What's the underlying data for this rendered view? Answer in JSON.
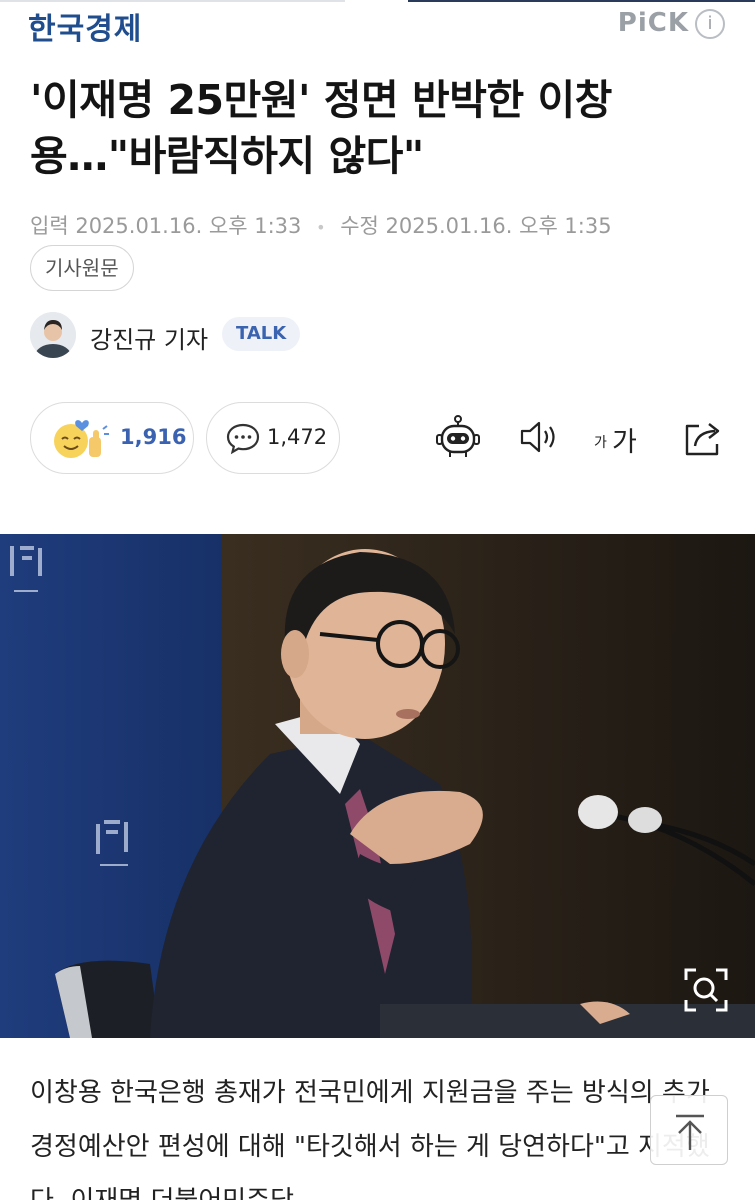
{
  "header": {
    "brand": "한국경제",
    "pick": "PiCK",
    "info": "i"
  },
  "article": {
    "headline": "'이재명 25만원' 정면 반박한 이창용…\"바람직하지 않다\"",
    "input_label": "입력",
    "input_date": "2025.01.16. 오후 1:33",
    "separator": "•",
    "edit_label": "수정",
    "edit_date": "2025.01.16. 오후 1:35",
    "source_button": "기사원문",
    "reporter": "강진규 기자",
    "talk": "TALK",
    "body": "이창용 한국은행 총재가 전국민에게 지원금을 주는 방식의 추가경정예산안 편성에 대해 \"타깃해서 하는 게 당연하다\"고 지적했다. 이재명 더불어민주당"
  },
  "reactions": {
    "likes": "1,916",
    "comments": "1,472"
  },
  "tools": {
    "font_small": "가",
    "font_big": "가"
  },
  "icons": [
    "robot-icon",
    "speaker-icon",
    "font-size-icon",
    "share-icon",
    "comment-icon",
    "zoom-icon",
    "arrow-up-icon"
  ],
  "colors": {
    "brand": "#1f4d8e",
    "accent": "#3b64b0",
    "muted": "#9a9a9a"
  }
}
